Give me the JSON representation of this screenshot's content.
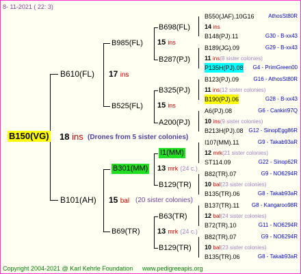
{
  "header_date": "8- 11-2021 ( 22: 3)",
  "footer": {
    "copyright": "Copyright 2004-2021 @ Karl Kehrle Foundation",
    "url": "www.pedigreeapis.org"
  },
  "colors": {
    "frame": "#ff33cc",
    "ins": "#cc0000",
    "mrk": "#cc0000",
    "bal": "#cc0000",
    "note": "#7040a0",
    "code": "#0000cc",
    "sub": "#a080c0",
    "yellow": "#ffff00",
    "green": "#22dd22",
    "cyan": "#00ffff"
  },
  "root": {
    "id": "B150(VG)",
    "n": "18",
    "unit": "ins",
    "note": "(Drones from 5 sister colonies)"
  },
  "gen1": [
    {
      "id": "B610(FL)",
      "n": "17",
      "unit": "ins"
    },
    {
      "id": "B101(AH)",
      "n": "15",
      "unit": "bal",
      "note": "(20 sister colonies)"
    }
  ],
  "gen2": [
    {
      "id": "B985(FL)",
      "n": "15",
      "unit": "ins"
    },
    {
      "id": "B525(FL)",
      "n": "15",
      "unit": "ins"
    },
    {
      "id": "B301(MM)",
      "n": "13",
      "unit": "mrk",
      "sub": "(24 c.)"
    },
    {
      "id": "B69(TR)",
      "n": "13",
      "unit": "mrk",
      "sub": "(24 c.)"
    }
  ],
  "gen3": [
    {
      "id": "B698(FL)"
    },
    {
      "id": "B287(PJ)"
    },
    {
      "id": "B325(PJ)"
    },
    {
      "id": "A200(PJ)"
    },
    {
      "id": "I1(MM)"
    },
    {
      "id": "B129(TR)"
    },
    {
      "id": "B63(TR)"
    },
    {
      "id": "B129(TR)"
    }
  ],
  "gen4": [
    {
      "top": "B550(JAF).10G16",
      "code": "AthosSt80R",
      "n": "14",
      "unit": "ins",
      "sub": "",
      "bottom": "B148(PJ).11",
      "code2": "G30 - B-xx43"
    },
    {
      "top": "B189(JG).09",
      "code": "G29 - B-xx43",
      "n": "11",
      "unit": "ins",
      "sub": "(8 sister colonies)",
      "bottom": "P135H(PJ).08",
      "code2": "G4 - PrimGreen00"
    },
    {
      "top": "B123(PJ).09",
      "code": "G16 - AthosSt80R",
      "n": "11",
      "unit": "ins",
      "sub": "(12 sister colonies)",
      "bottom": "B190(PJ).06",
      "code2": "G28 - B-xx43"
    },
    {
      "top": "A6(PJ).08",
      "code": "G6 - Cankiri97Q",
      "n": "10",
      "unit": "ins",
      "sub": "(9 sister colonies)",
      "bottom": "B213H(PJ).08",
      "code2": "G12 - SinopEgg86R"
    },
    {
      "top": "I107(MM).11",
      "code": "G9 - Takab93aR",
      "n": "12",
      "unit": "mrk",
      "sub": "(21 sister colonies)",
      "bottom": "ST114.09",
      "code2": "G22 - Sinop62R"
    },
    {
      "top": "B82(TR).07",
      "code": "G9 - NO6294R",
      "n": "10",
      "unit": "bal",
      "sub": "(23 sister colonies)",
      "bottom": "B135(TR).06",
      "code2": "G8 - Takab93aR"
    },
    {
      "top": "B137(TR).11",
      "code": "G8 - Kangaroo98R",
      "n": "12",
      "unit": "bal",
      "sub": "(24 sister colonies)",
      "bottom": "B72(TR).10",
      "code2": "G11 - NO6294R"
    },
    {
      "top": "B82(TR).07",
      "code": "G9 - NO6294R",
      "n": "10",
      "unit": "bal",
      "sub": "(23 sister colonies)",
      "bottom": "B135(TR).06",
      "code2": "G8 - Takab93aR"
    }
  ]
}
